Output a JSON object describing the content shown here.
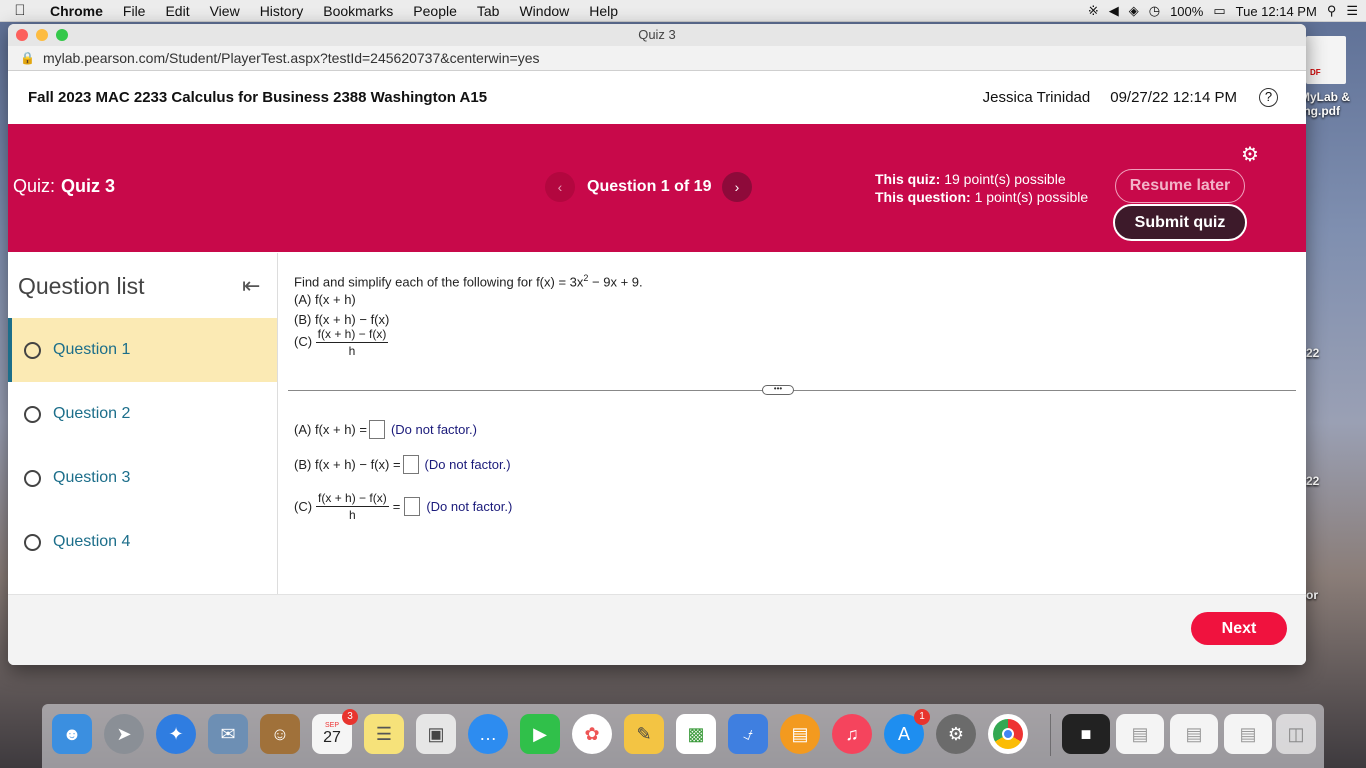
{
  "menubar": {
    "apple": "",
    "items": [
      "Chrome",
      "File",
      "Edit",
      "View",
      "History",
      "Bookmarks",
      "People",
      "Tab",
      "Window",
      "Help"
    ],
    "battery": "100%",
    "clock": "Tue 12:14 PM"
  },
  "desktop": {
    "file_tag": "DF",
    "file_label_1": "MyLab &",
    "file_label_2": "ing.pdf",
    "label_a": "22",
    "label_b": "22",
    "label_c": "or"
  },
  "window": {
    "title": "Quiz 3",
    "url": "mylab.pearson.com/Student/PlayerTest.aspx?testId=245620737&centerwin=yes"
  },
  "header": {
    "course": "Fall 2023 MAC 2233 Calculus for Business 2388 Washington A15",
    "user": "Jessica Trinidad",
    "datetime": "09/27/22 12:14 PM",
    "help": "?"
  },
  "banner": {
    "quiz_prefix": "Quiz:",
    "quiz_name": "Quiz 3",
    "prev": "‹",
    "next": "›",
    "question_position": "Question 1 of 19",
    "quiz_points_label": "This quiz:",
    "quiz_points_value": "19 point(s) possible",
    "question_points_label": "This question:",
    "question_points_value": "1 point(s) possible",
    "resume_label": "Resume later",
    "submit_label": "Submit quiz"
  },
  "question_list": {
    "title": "Question list",
    "items": [
      {
        "label": "Question 1"
      },
      {
        "label": "Question 2"
      },
      {
        "label": "Question 3"
      },
      {
        "label": "Question 4"
      }
    ]
  },
  "question": {
    "prompt_pre": "Find and simplify each of the following for f(x) = 3x",
    "prompt_exp": "2",
    "prompt_post": " − 9x + 9.",
    "part_a": "(A) f(x + h)",
    "part_b": "(B) f(x + h) − f(x)",
    "part_c_prefix": "(C)",
    "frac_num": "f(x + h) − f(x)",
    "frac_den": "h",
    "grip": "•••",
    "answer_a_prefix": "(A) f(x + h) =",
    "answer_b_prefix": "(B) f(x + h) − f(x) =",
    "answer_c_prefix": "(C)",
    "answer_c_equals": "=",
    "hint": "(Do not factor.)"
  },
  "footer": {
    "next_label": "Next"
  },
  "dock": {
    "calendar_month": "SEP",
    "calendar_day": "27",
    "calendar_badge": "3",
    "appstore_badge": "1"
  }
}
